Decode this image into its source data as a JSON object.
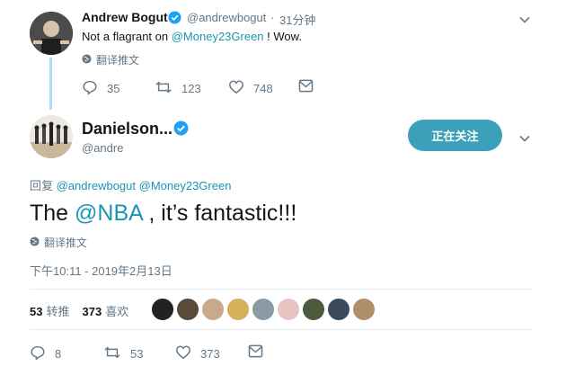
{
  "parent": {
    "name": "Andrew Bogut",
    "handle": "@andrewbogut",
    "dot": "·",
    "time": "31分钟",
    "text_before": "Not a flagrant on ",
    "text_mention": "@Money23Green",
    "text_after": " ! Wow.",
    "translate": "翻译推文",
    "actions": {
      "reply": "35",
      "retweet": "123",
      "like": "748"
    }
  },
  "main": {
    "name": "Danielson...",
    "handle": "@andre",
    "follow_label": "正在关注",
    "reply_prefix": "回复 ",
    "reply_to_1": "@andrewbogut",
    "reply_to_2": "@Money23Green",
    "text_before": "The ",
    "text_mention": "@NBA",
    "text_after": " , it’s fantastic!!!",
    "translate": "翻译推文",
    "timestamp": "下午10:11 - 2019年2月13日",
    "stats": {
      "retweets_count": "53",
      "retweets_label": "转推",
      "likes_count": "373",
      "likes_label": "喜欢"
    },
    "actions": {
      "reply": "8",
      "retweet": "53",
      "like": "373"
    }
  },
  "colors": {
    "accent": "#1b95b2",
    "follow_button": "#3da0ba",
    "verified": "#1da1f2",
    "muted": "#657786",
    "thread_line": "#aeddf8"
  },
  "icons": [
    "verified-badge-icon",
    "chevron-down-icon",
    "globe-icon",
    "reply-icon",
    "retweet-icon",
    "like-icon",
    "direct-message-icon"
  ],
  "likers": [
    {
      "color": "#222222"
    },
    {
      "color": "#5a4a3a"
    },
    {
      "color": "#c9a98c"
    },
    {
      "color": "#d4b05a"
    },
    {
      "color": "#8c9aa6"
    },
    {
      "color": "#e7c4c0"
    },
    {
      "color": "#4a5a3a"
    },
    {
      "color": "#3a4a5a"
    },
    {
      "color": "#b0906a"
    }
  ]
}
